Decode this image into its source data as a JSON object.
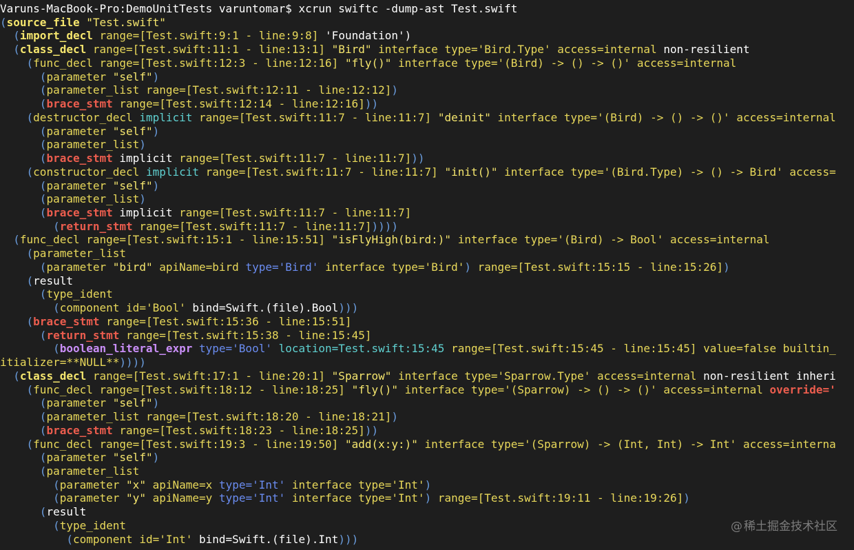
{
  "theme": {
    "background": "#1e1e1e",
    "colors": {
      "p": "#6b9ee0",
      "k": "#f5e66e",
      "g": "#f5e66e",
      "t": "#dcdcdc",
      "y": "#e8d85a",
      "x": "#ffffff",
      "r": "#ec5d4e",
      "v": "#c98ef7",
      "c": "#5fd0d0",
      "b": "#6a8cf0"
    },
    "bold": [
      "k",
      "r",
      "v"
    ]
  },
  "terminal": {
    "lines": [
      [
        [
          "x",
          "Varuns-MacBook-Pro:DemoUnitTests varuntomar$ xcrun swiftc -dump-ast Test.swift"
        ]
      ],
      [
        [
          "p",
          "("
        ],
        [
          "k",
          "source_file"
        ],
        [
          "t",
          " "
        ],
        [
          "g",
          "\"Test.swift\""
        ]
      ],
      [
        [
          "t",
          "  "
        ],
        [
          "p",
          "("
        ],
        [
          "k",
          "import_decl"
        ],
        [
          "t",
          " "
        ],
        [
          "y",
          "range=[Test.swift:9:1 - line:9:8]"
        ],
        [
          "t",
          " "
        ],
        [
          "x",
          "'Foundation')"
        ]
      ],
      [
        [
          "t",
          "  "
        ],
        [
          "p",
          "("
        ],
        [
          "k",
          "class_decl"
        ],
        [
          "t",
          " "
        ],
        [
          "y",
          "range=[Test.swift:11:1 - line:13:1]"
        ],
        [
          "t",
          " "
        ],
        [
          "g",
          "\"Bird\""
        ],
        [
          "t",
          " "
        ],
        [
          "y",
          "interface type='Bird.Type'"
        ],
        [
          "t",
          " "
        ],
        [
          "y",
          "access=internal"
        ],
        [
          "t",
          " "
        ],
        [
          "x",
          "non-resilient"
        ]
      ],
      [
        [
          "t",
          "    "
        ],
        [
          "p",
          "("
        ],
        [
          "y",
          "func_decl"
        ],
        [
          "t",
          " "
        ],
        [
          "y",
          "range=[Test.swift:12:3 - line:12:16]"
        ],
        [
          "t",
          " "
        ],
        [
          "g",
          "\"fly()\""
        ],
        [
          "t",
          " "
        ],
        [
          "y",
          "interface type='(Bird) -> () -> ()'"
        ],
        [
          "t",
          " "
        ],
        [
          "y",
          "access=internal"
        ]
      ],
      [
        [
          "t",
          "      "
        ],
        [
          "p",
          "("
        ],
        [
          "y",
          "parameter"
        ],
        [
          "t",
          " "
        ],
        [
          "g",
          "\"self\""
        ],
        [
          "p",
          ")"
        ]
      ],
      [
        [
          "t",
          "      "
        ],
        [
          "p",
          "("
        ],
        [
          "y",
          "parameter_list"
        ],
        [
          "t",
          " "
        ],
        [
          "y",
          "range=[Test.swift:12:11 - line:12:12]"
        ],
        [
          "p",
          ")"
        ]
      ],
      [
        [
          "t",
          "      "
        ],
        [
          "p",
          "("
        ],
        [
          "r",
          "brace_stmt"
        ],
        [
          "t",
          " "
        ],
        [
          "y",
          "range=[Test.swift:12:14 - line:12:16]"
        ],
        [
          "p",
          "))"
        ]
      ],
      [
        [
          "t",
          "    "
        ],
        [
          "p",
          "("
        ],
        [
          "y",
          "destructor_decl"
        ],
        [
          "t",
          " "
        ],
        [
          "c",
          "implicit"
        ],
        [
          "t",
          " "
        ],
        [
          "y",
          "range=[Test.swift:11:7 - line:11:7]"
        ],
        [
          "t",
          " "
        ],
        [
          "g",
          "\"deinit\""
        ],
        [
          "t",
          " "
        ],
        [
          "y",
          "interface type='(Bird) -> () -> ()'"
        ],
        [
          "t",
          " "
        ],
        [
          "y",
          "access=internal"
        ]
      ],
      [
        [
          "t",
          "      "
        ],
        [
          "p",
          "("
        ],
        [
          "y",
          "parameter"
        ],
        [
          "t",
          " "
        ],
        [
          "g",
          "\"self\""
        ],
        [
          "p",
          ")"
        ]
      ],
      [
        [
          "t",
          "      "
        ],
        [
          "p",
          "("
        ],
        [
          "y",
          "parameter_list"
        ],
        [
          "p",
          ")"
        ]
      ],
      [
        [
          "t",
          "      "
        ],
        [
          "p",
          "("
        ],
        [
          "r",
          "brace_stmt"
        ],
        [
          "t",
          " "
        ],
        [
          "x",
          "implicit"
        ],
        [
          "t",
          " "
        ],
        [
          "y",
          "range=[Test.swift:11:7 - line:11:7]"
        ],
        [
          "p",
          "))"
        ]
      ],
      [
        [
          "t",
          "    "
        ],
        [
          "p",
          "("
        ],
        [
          "y",
          "constructor_decl"
        ],
        [
          "t",
          " "
        ],
        [
          "c",
          "implicit"
        ],
        [
          "t",
          " "
        ],
        [
          "y",
          "range=[Test.swift:11:7 - line:11:7]"
        ],
        [
          "t",
          " "
        ],
        [
          "g",
          "\"init()\""
        ],
        [
          "t",
          " "
        ],
        [
          "y",
          "interface type='(Bird.Type) -> () -> Bird'"
        ],
        [
          "t",
          " "
        ],
        [
          "y",
          "access="
        ]
      ],
      [
        [
          "t",
          "      "
        ],
        [
          "p",
          "("
        ],
        [
          "y",
          "parameter"
        ],
        [
          "t",
          " "
        ],
        [
          "g",
          "\"self\""
        ],
        [
          "p",
          ")"
        ]
      ],
      [
        [
          "t",
          "      "
        ],
        [
          "p",
          "("
        ],
        [
          "y",
          "parameter_list"
        ],
        [
          "p",
          ")"
        ]
      ],
      [
        [
          "t",
          "      "
        ],
        [
          "p",
          "("
        ],
        [
          "r",
          "brace_stmt"
        ],
        [
          "t",
          " "
        ],
        [
          "x",
          "implicit"
        ],
        [
          "t",
          " "
        ],
        [
          "y",
          "range=[Test.swift:11:7 - line:11:7]"
        ]
      ],
      [
        [
          "t",
          "        "
        ],
        [
          "p",
          "("
        ],
        [
          "r",
          "return_stmt"
        ],
        [
          "t",
          " "
        ],
        [
          "y",
          "range=[Test.swift:11:7 - line:11:7]"
        ],
        [
          "p",
          "))))"
        ]
      ],
      [
        [
          "t",
          "  "
        ],
        [
          "p",
          "("
        ],
        [
          "y",
          "func_decl"
        ],
        [
          "t",
          " "
        ],
        [
          "y",
          "range=[Test.swift:15:1 - line:15:51]"
        ],
        [
          "t",
          " "
        ],
        [
          "g",
          "\"isFlyHigh(bird:)\""
        ],
        [
          "t",
          " "
        ],
        [
          "y",
          "interface type='(Bird) -> Bool'"
        ],
        [
          "t",
          " "
        ],
        [
          "y",
          "access=internal"
        ]
      ],
      [
        [
          "t",
          "    "
        ],
        [
          "p",
          "("
        ],
        [
          "y",
          "parameter_list"
        ]
      ],
      [
        [
          "t",
          "      "
        ],
        [
          "p",
          "("
        ],
        [
          "y",
          "parameter"
        ],
        [
          "t",
          " "
        ],
        [
          "g",
          "\"bird\""
        ],
        [
          "t",
          " "
        ],
        [
          "y",
          "apiName=bird"
        ],
        [
          "t",
          " "
        ],
        [
          "b",
          "type='Bird'"
        ],
        [
          "t",
          " "
        ],
        [
          "y",
          "interface type='Bird'"
        ],
        [
          "p",
          ")"
        ],
        [
          "t",
          " "
        ],
        [
          "y",
          "range=[Test.swift:15:15 - line:15:26]"
        ],
        [
          "p",
          ")"
        ]
      ],
      [
        [
          "t",
          "    "
        ],
        [
          "p",
          "("
        ],
        [
          "x",
          "result"
        ]
      ],
      [
        [
          "t",
          "      "
        ],
        [
          "p",
          "("
        ],
        [
          "y",
          "type_ident"
        ]
      ],
      [
        [
          "t",
          "        "
        ],
        [
          "p",
          "("
        ],
        [
          "y",
          "component"
        ],
        [
          "t",
          " "
        ],
        [
          "y",
          "id='Bool'"
        ],
        [
          "t",
          " "
        ],
        [
          "x",
          "bind=Swift.(file).Bool"
        ],
        [
          "p",
          ")))"
        ]
      ],
      [
        [
          "t",
          "    "
        ],
        [
          "p",
          "("
        ],
        [
          "r",
          "brace_stmt"
        ],
        [
          "t",
          " "
        ],
        [
          "y",
          "range=[Test.swift:15:36 - line:15:51]"
        ]
      ],
      [
        [
          "t",
          "      "
        ],
        [
          "p",
          "("
        ],
        [
          "r",
          "return_stmt"
        ],
        [
          "t",
          " "
        ],
        [
          "y",
          "range=[Test.swift:15:38 - line:15:45]"
        ]
      ],
      [
        [
          "t",
          "        "
        ],
        [
          "p",
          "("
        ],
        [
          "v",
          "boolean_literal_expr"
        ],
        [
          "t",
          " "
        ],
        [
          "b",
          "type='Bool'"
        ],
        [
          "t",
          " "
        ],
        [
          "c",
          "location=Test.swift:15:45"
        ],
        [
          "t",
          " "
        ],
        [
          "y",
          "range=[Test.swift:15:45 - line:15:45]"
        ],
        [
          "t",
          " "
        ],
        [
          "y",
          "value=false builtin_"
        ]
      ],
      [
        [
          "y",
          "itializer=**NULL**"
        ],
        [
          "p",
          "))))"
        ]
      ],
      [
        [
          "t",
          "  "
        ],
        [
          "p",
          "("
        ],
        [
          "k",
          "class_decl"
        ],
        [
          "t",
          " "
        ],
        [
          "y",
          "range=[Test.swift:17:1 - line:20:1]"
        ],
        [
          "t",
          " "
        ],
        [
          "g",
          "\"Sparrow\""
        ],
        [
          "t",
          " "
        ],
        [
          "y",
          "interface type='Sparrow.Type'"
        ],
        [
          "t",
          " "
        ],
        [
          "y",
          "access=internal"
        ],
        [
          "t",
          " "
        ],
        [
          "x",
          "non-resilient inheri"
        ]
      ],
      [
        [
          "t",
          "    "
        ],
        [
          "p",
          "("
        ],
        [
          "y",
          "func_decl"
        ],
        [
          "t",
          " "
        ],
        [
          "y",
          "range=[Test.swift:18:12 - line:18:25]"
        ],
        [
          "t",
          " "
        ],
        [
          "g",
          "\"fly()\""
        ],
        [
          "t",
          " "
        ],
        [
          "y",
          "interface type='(Sparrow) -> () -> ()'"
        ],
        [
          "t",
          " "
        ],
        [
          "y",
          "access=internal"
        ],
        [
          "t",
          " "
        ],
        [
          "r",
          "override='"
        ]
      ],
      [
        [
          "t",
          "      "
        ],
        [
          "p",
          "("
        ],
        [
          "y",
          "parameter"
        ],
        [
          "t",
          " "
        ],
        [
          "g",
          "\"self\""
        ],
        [
          "p",
          ")"
        ]
      ],
      [
        [
          "t",
          "      "
        ],
        [
          "p",
          "("
        ],
        [
          "y",
          "parameter_list"
        ],
        [
          "t",
          " "
        ],
        [
          "y",
          "range=[Test.swift:18:20 - line:18:21]"
        ],
        [
          "p",
          ")"
        ]
      ],
      [
        [
          "t",
          "      "
        ],
        [
          "p",
          "("
        ],
        [
          "r",
          "brace_stmt"
        ],
        [
          "t",
          " "
        ],
        [
          "y",
          "range=[Test.swift:18:23 - line:18:25]"
        ],
        [
          "p",
          "))"
        ]
      ],
      [
        [
          "t",
          "    "
        ],
        [
          "p",
          "("
        ],
        [
          "y",
          "func_decl"
        ],
        [
          "t",
          " "
        ],
        [
          "y",
          "range=[Test.swift:19:3 - line:19:50]"
        ],
        [
          "t",
          " "
        ],
        [
          "g",
          "\"add(x:y:)\""
        ],
        [
          "t",
          " "
        ],
        [
          "y",
          "interface type='(Sparrow) -> (Int, Int) -> Int'"
        ],
        [
          "t",
          " "
        ],
        [
          "y",
          "access=interna"
        ]
      ],
      [
        [
          "t",
          "      "
        ],
        [
          "p",
          "("
        ],
        [
          "y",
          "parameter"
        ],
        [
          "t",
          " "
        ],
        [
          "g",
          "\"self\""
        ],
        [
          "p",
          ")"
        ]
      ],
      [
        [
          "t",
          "      "
        ],
        [
          "p",
          "("
        ],
        [
          "y",
          "parameter_list"
        ]
      ],
      [
        [
          "t",
          "        "
        ],
        [
          "p",
          "("
        ],
        [
          "y",
          "parameter"
        ],
        [
          "t",
          " "
        ],
        [
          "g",
          "\"x\""
        ],
        [
          "t",
          " "
        ],
        [
          "y",
          "apiName=x"
        ],
        [
          "t",
          " "
        ],
        [
          "b",
          "type='Int'"
        ],
        [
          "t",
          " "
        ],
        [
          "y",
          "interface type='Int'"
        ],
        [
          "p",
          ")"
        ]
      ],
      [
        [
          "t",
          "        "
        ],
        [
          "p",
          "("
        ],
        [
          "y",
          "parameter"
        ],
        [
          "t",
          " "
        ],
        [
          "g",
          "\"y\""
        ],
        [
          "t",
          " "
        ],
        [
          "y",
          "apiName=y"
        ],
        [
          "t",
          " "
        ],
        [
          "b",
          "type='Int'"
        ],
        [
          "t",
          " "
        ],
        [
          "y",
          "interface type='Int'"
        ],
        [
          "p",
          ")"
        ],
        [
          "t",
          " "
        ],
        [
          "y",
          "range=[Test.swift:19:11 - line:19:26]"
        ],
        [
          "p",
          ")"
        ]
      ],
      [
        [
          "t",
          "      "
        ],
        [
          "p",
          "("
        ],
        [
          "x",
          "result"
        ]
      ],
      [
        [
          "t",
          "        "
        ],
        [
          "p",
          "("
        ],
        [
          "y",
          "type_ident"
        ]
      ],
      [
        [
          "t",
          "          "
        ],
        [
          "p",
          "("
        ],
        [
          "y",
          "component"
        ],
        [
          "t",
          " "
        ],
        [
          "y",
          "id='Int'"
        ],
        [
          "t",
          " "
        ],
        [
          "x",
          "bind=Swift.(file).Int"
        ],
        [
          "p",
          ")))"
        ]
      ]
    ]
  },
  "watermark": {
    "at": "@",
    "text": "稀土掘金技术社区"
  }
}
